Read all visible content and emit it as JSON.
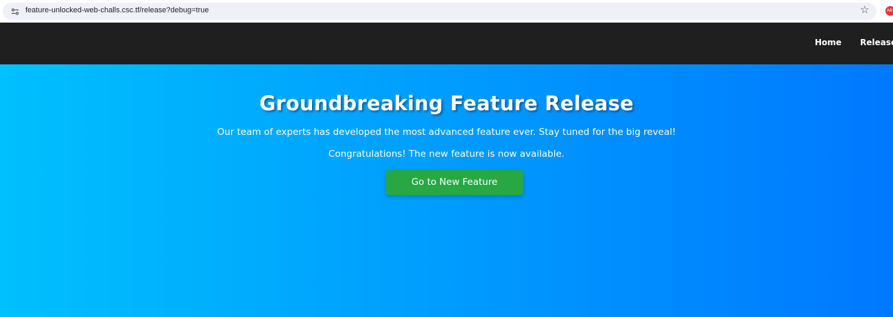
{
  "browser": {
    "url": "feature-unlocked-web-challs.csc.tf/release?debug=true",
    "bookmark_icon": "star-icon",
    "site_info_icon": "tune-icon",
    "profile_badge": "AB"
  },
  "navbar": {
    "links": [
      {
        "label": "Home"
      },
      {
        "label": "Release"
      }
    ]
  },
  "hero": {
    "title": "Groundbreaking Feature Release",
    "description": "Our team of experts has developed the most advanced feature ever. Stay tuned for the big reveal!",
    "status": "Congratulations! The new feature is now available.",
    "button_label": "Go to New Feature",
    "gradient_start": "#00c0fd",
    "gradient_end": "#0078fe",
    "button_color": "#28a745"
  }
}
